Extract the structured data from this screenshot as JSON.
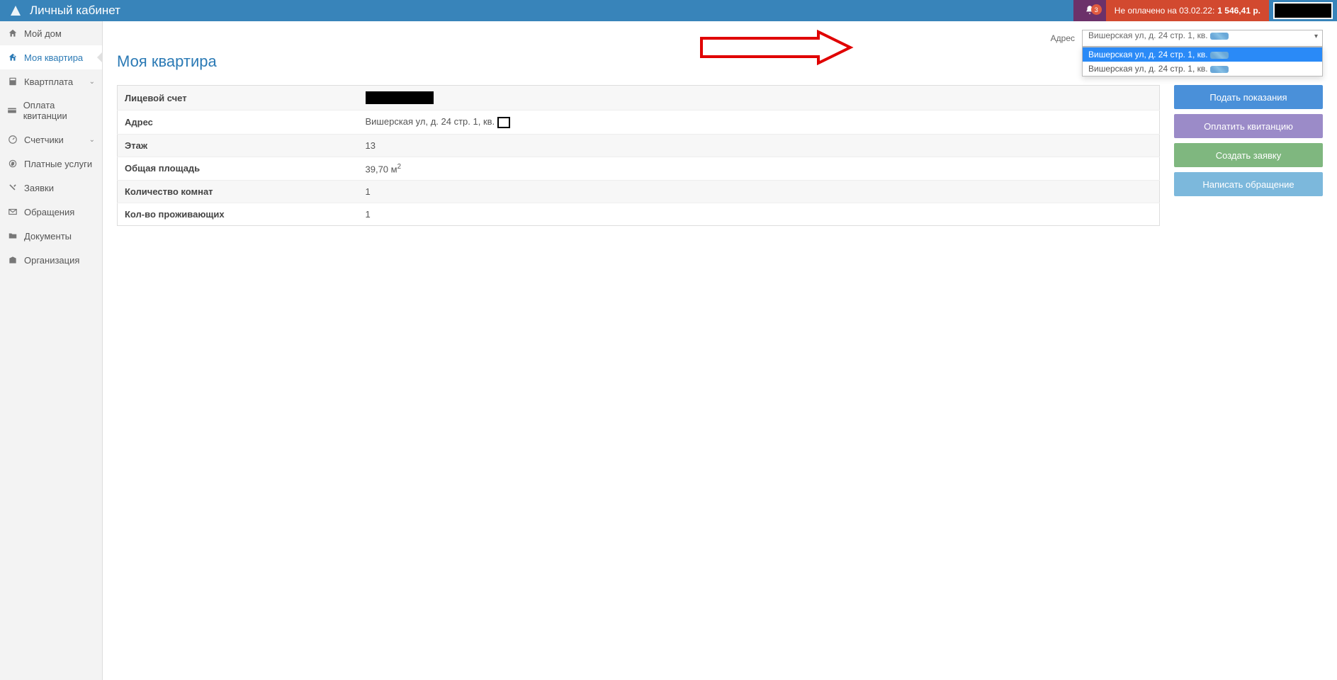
{
  "header": {
    "title": "Личный кабинет",
    "notification_count": "3",
    "unpaid_label": "Не оплачено на 03.02.22:",
    "unpaid_amount": "1 546,41 р."
  },
  "sidebar": {
    "items": [
      {
        "label": "Мой дом",
        "icon": "home"
      },
      {
        "label": "Моя квартира",
        "icon": "key",
        "active": true
      },
      {
        "label": "Квартплата",
        "icon": "calculator",
        "chevron": true
      },
      {
        "label": "Оплата квитанции",
        "icon": "card"
      },
      {
        "label": "Счетчики",
        "icon": "meter",
        "chevron": true
      },
      {
        "label": "Платные услуги",
        "icon": "coin"
      },
      {
        "label": "Заявки",
        "icon": "tools"
      },
      {
        "label": "Обращения",
        "icon": "mail"
      },
      {
        "label": "Документы",
        "icon": "folder"
      },
      {
        "label": "Организация",
        "icon": "org"
      }
    ]
  },
  "address": {
    "label": "Адрес",
    "selected": "Вишерская ул, д. 24 стр. 1, кв.",
    "options": [
      "Вишерская ул, д. 24 стр. 1, кв.",
      "Вишерская ул, д. 24 стр. 1, кв."
    ]
  },
  "page": {
    "title": "Моя квартира"
  },
  "info": {
    "rows": [
      {
        "label": "Лицевой счет",
        "value": ""
      },
      {
        "label": "Адрес",
        "value": "Вишерская ул, д. 24 стр. 1, кв."
      },
      {
        "label": "Этаж",
        "value": "13"
      },
      {
        "label": "Общая площадь",
        "value": "39,70 м²"
      },
      {
        "label": "Количество комнат",
        "value": "1"
      },
      {
        "label": "Кол-во проживающих",
        "value": "1"
      }
    ]
  },
  "actions": {
    "submit_readings": "Подать показания",
    "pay_receipt": "Оплатить квитанцию",
    "create_request": "Создать заявку",
    "write_appeal": "Написать обращение"
  }
}
